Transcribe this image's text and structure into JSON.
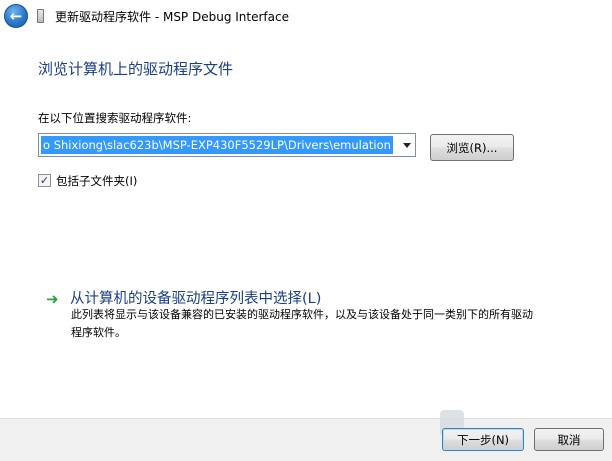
{
  "window": {
    "title": "更新驱动程序软件 - MSP Debug Interface"
  },
  "page": {
    "heading": "浏览计算机上的驱动程序文件"
  },
  "search": {
    "label": "在以下位置搜索驱动程序软件:",
    "path_value": "o Shixiong\\slac623b\\MSP-EXP430F5529LP\\Drivers\\emulation",
    "browse_label": "浏览(R)..."
  },
  "subfolders": {
    "label": "包括子文件夹(I)",
    "checked": true,
    "check_glyph": "✓"
  },
  "option": {
    "title": "从计算机的设备驱动程序列表中选择(L)",
    "description": "此列表将显示与该设备兼容的已安装的驱动程序软件，以及与该设备处于同一类别下的所有驱动程序软件。",
    "icon": "green-arrow-icon",
    "icon_glyph": "➜"
  },
  "footer": {
    "next_label": "下一步(N)",
    "cancel_label": "取消"
  },
  "icons": {
    "back": "back-arrow-icon",
    "back_glyph": "←",
    "device": "device-icon"
  },
  "colors": {
    "heading": "#1a3e8c",
    "selection": "#3399ff",
    "arrow": "#2aa33a",
    "footer_bg": "#f0f0f0"
  }
}
